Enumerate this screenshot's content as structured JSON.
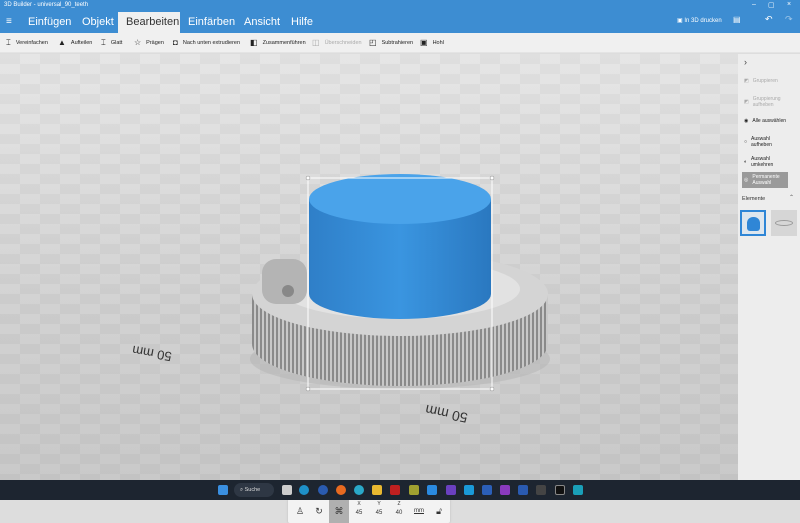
{
  "window": {
    "title": "3D Builder - universal_90_teeth",
    "min": "–",
    "max": "▢",
    "close": "×"
  },
  "menu": {
    "tabs": [
      "Einfügen",
      "Objekt",
      "Bearbeiten",
      "Einfärben",
      "Ansicht",
      "Hilfe"
    ],
    "active": "Bearbeiten",
    "print_label": "In 3D drucken"
  },
  "toolbar": [
    {
      "label": "Vereinfachen",
      "icon": "simplify-icon",
      "enabled": true
    },
    {
      "label": "Aufteilen",
      "icon": "split-icon",
      "enabled": true
    },
    {
      "label": "Glatt",
      "icon": "smooth-icon",
      "enabled": true
    },
    {
      "label": "Prägen",
      "icon": "emboss-icon",
      "enabled": true
    },
    {
      "label": "Nach unten extrudieren",
      "icon": "extrude-down-icon",
      "enabled": true
    },
    {
      "label": "Zusammenführen",
      "icon": "merge-icon",
      "enabled": true
    },
    {
      "label": "Überschneiden",
      "icon": "intersect-icon",
      "enabled": false
    },
    {
      "label": "Subtrahieren",
      "icon": "subtract-icon",
      "enabled": true
    },
    {
      "label": "Hohl",
      "icon": "hollow-icon",
      "enabled": true
    }
  ],
  "side": {
    "items": [
      {
        "label": "Gruppieren",
        "enabled": false
      },
      {
        "label": "Gruppierung aufheben",
        "enabled": false
      },
      {
        "label": "Alle auswählen",
        "enabled": true
      },
      {
        "label": "Auswahl aufheben",
        "enabled": true
      },
      {
        "label": "Auswahl umkehren",
        "enabled": true
      },
      {
        "label": "Permanente Auswahl",
        "enabled": true,
        "selected": true
      }
    ],
    "elements_label": "Elemente"
  },
  "scene": {
    "dim1": "50 mm",
    "dim2": "50 mm"
  },
  "controls": {
    "x_label": "X",
    "x": "45",
    "y_label": "Y",
    "y": "45",
    "z_label": "Z",
    "z": "40",
    "unit": "mm"
  },
  "taskbar": {
    "search": "Suche"
  },
  "colors": {
    "accent": "#3d8dd2",
    "object": "#2f86d6"
  }
}
